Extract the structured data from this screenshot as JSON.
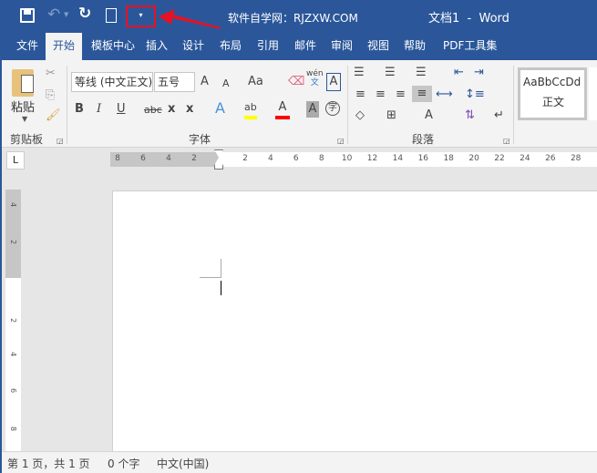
{
  "titlebar": {
    "site_label": "软件自学网：RJZXW.COM",
    "doc_title": "文档1  -  Word",
    "qat": [
      "save-icon",
      "undo-icon",
      "redo-icon",
      "new-document-icon",
      "customize-qat-dropdown-icon"
    ],
    "highlight_color": "#e81123"
  },
  "tabs": [
    {
      "label": "文件"
    },
    {
      "label": "开始",
      "active": true
    },
    {
      "label": "模板中心"
    },
    {
      "label": "插入"
    },
    {
      "label": "设计"
    },
    {
      "label": "布局"
    },
    {
      "label": "引用"
    },
    {
      "label": "邮件"
    },
    {
      "label": "审阅"
    },
    {
      "label": "视图"
    },
    {
      "label": "帮助"
    },
    {
      "label": "PDF工具集"
    }
  ],
  "ribbon": {
    "clipboard": {
      "label": "剪贴板",
      "paste": "粘贴"
    },
    "font": {
      "label": "字体",
      "font_name": "等线 (中文正文)",
      "font_size": "五号",
      "grow": "A",
      "shrink": "A",
      "case": "Aa",
      "phonetic_top": "wén",
      "phonetic_bottom": "文",
      "border_char": "A",
      "bold": "B",
      "italic": "I",
      "underline": "U",
      "strike": "abc",
      "sub": "x",
      "sup": "x",
      "effects": "A",
      "highlight": "ab",
      "color": "A",
      "shade": "A",
      "enclose": "字",
      "highlight_color": "#ffff00",
      "font_color": "#ff0000"
    },
    "paragraph": {
      "label": "段落"
    },
    "styles": {
      "normal_preview": "AaBbCcDd",
      "normal_label": "正文"
    }
  },
  "ruler": {
    "h_left": [
      "8",
      "6",
      "4",
      "2"
    ],
    "h_right": [
      "2",
      "4",
      "6",
      "8",
      "10",
      "12",
      "14",
      "16",
      "18",
      "20",
      "22",
      "24",
      "26",
      "28"
    ],
    "v_top": [
      "4",
      "2"
    ],
    "v_bottom": [
      "2",
      "4",
      "6",
      "8"
    ],
    "tab_selector": "L"
  },
  "status": {
    "page": "第 1 页，共 1 页",
    "words": "0 个字",
    "lang": "中文(中国)"
  },
  "accent": "#2b579a"
}
